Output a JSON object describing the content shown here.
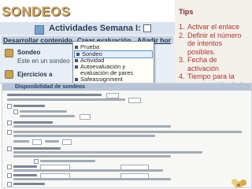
{
  "slide": {
    "title": "SONDEOS"
  },
  "moodle": {
    "section_title": "Actividades Semana I:",
    "nav": {
      "item1": "Desarrollar contenido",
      "item2": "Crear evaluación",
      "item3": "Añadir hor"
    },
    "rows": {
      "sondeo_label": "Sondeo",
      "partial_text": "Este en un sondeo",
      "ejercicios_label": "Ejercicios a"
    },
    "dropdown_items": [
      "Prueba",
      "Sondeo",
      "Actividad",
      "Autoevaluación y",
      "evaluación de pares",
      "Safeassignment"
    ]
  },
  "tips": {
    "header": "Tips",
    "items": [
      {
        "num": "1.",
        "text": "Activar el enlace"
      },
      {
        "num": "2.",
        "text": "Definir el número de intentos posibles."
      },
      {
        "num": "3.",
        "text": "Fecha de  activación"
      },
      {
        "num": "4.",
        "text": "Tiempo para la presentación de la evaluación"
      }
    ]
  },
  "form": {
    "section_header": "Disponibilidad de sondeos"
  },
  "colors": {
    "title_gold": "#c9a56a",
    "tips_red": "#a83636",
    "tips_bg": "#f3efe9",
    "moodle_blue": "#c6d2e2"
  }
}
